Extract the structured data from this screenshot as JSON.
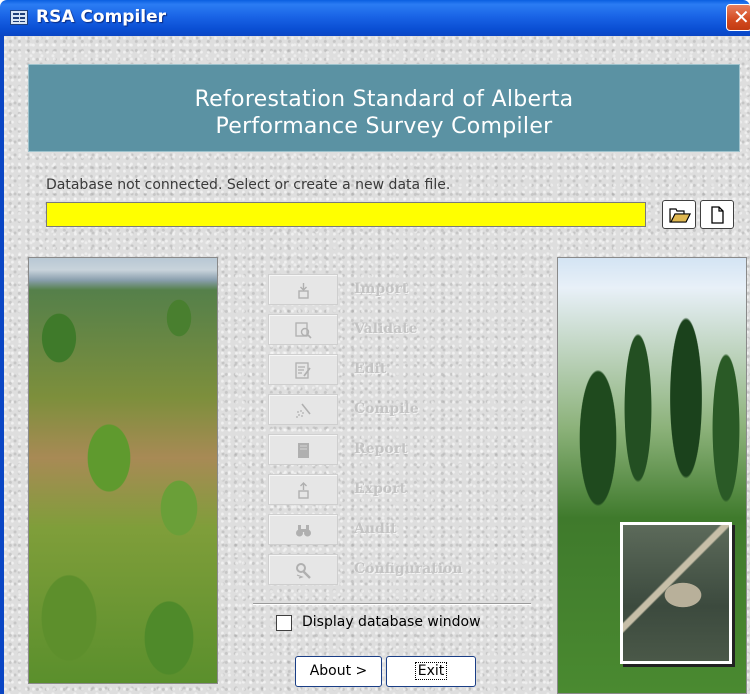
{
  "window": {
    "title": "RSA Compiler",
    "close_glyph": "✕"
  },
  "banner": {
    "line1": "Reforestation Standard of Alberta",
    "line2": "Performance Survey Compiler"
  },
  "status": {
    "message": "Database not connected.  Select or create a new data file.",
    "path_value": ""
  },
  "toolbar": {
    "open_icon": "open-folder-icon",
    "new_icon": "new-file-icon"
  },
  "commands": [
    {
      "label": "Import",
      "icon": "import-icon",
      "enabled": false
    },
    {
      "label": "Validate",
      "icon": "validate-icon",
      "enabled": false
    },
    {
      "label": "Edit",
      "icon": "edit-icon",
      "enabled": false
    },
    {
      "label": "Compile",
      "icon": "compile-icon",
      "enabled": false
    },
    {
      "label": "Report",
      "icon": "report-icon",
      "enabled": false
    },
    {
      "label": "Export",
      "icon": "export-icon",
      "enabled": false
    },
    {
      "label": "Audit",
      "icon": "binoculars-icon",
      "enabled": false
    },
    {
      "label": "Configuration",
      "icon": "configuration-icon",
      "enabled": false
    }
  ],
  "options": {
    "display_db_window_label": "Display database window",
    "display_db_window_checked": false
  },
  "buttons": {
    "about": "About >",
    "exit": "Exit"
  },
  "colors": {
    "titlebar": "#0a5fe0",
    "banner": "#5b92a3",
    "path_field": "#ffff00",
    "disabled_text": "#c4c4c4"
  }
}
